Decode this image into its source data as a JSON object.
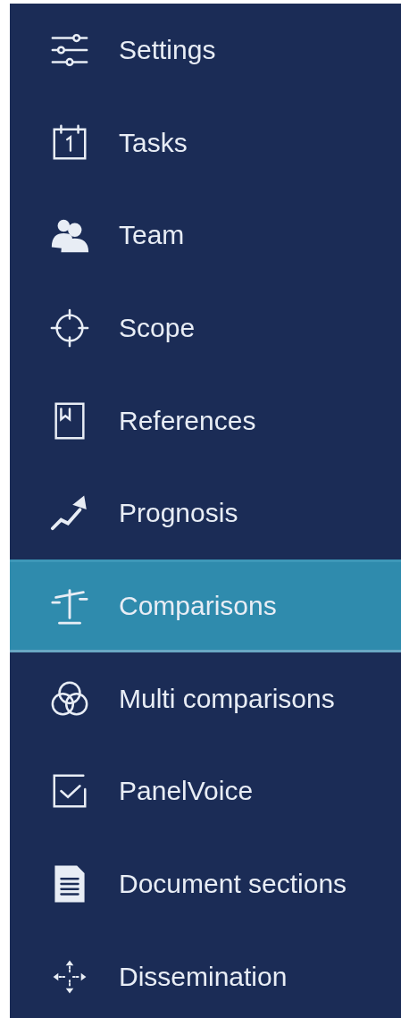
{
  "sidebar": {
    "items": [
      {
        "label": "Settings",
        "selected": false
      },
      {
        "label": "Tasks",
        "selected": false
      },
      {
        "label": "Team",
        "selected": false
      },
      {
        "label": "Scope",
        "selected": false
      },
      {
        "label": "References",
        "selected": false
      },
      {
        "label": "Prognosis",
        "selected": false
      },
      {
        "label": "Comparisons",
        "selected": true
      },
      {
        "label": "Multi comparisons",
        "selected": false
      },
      {
        "label": "PanelVoice",
        "selected": false
      },
      {
        "label": "Document sections",
        "selected": false
      },
      {
        "label": "Dissemination",
        "selected": false
      }
    ]
  }
}
